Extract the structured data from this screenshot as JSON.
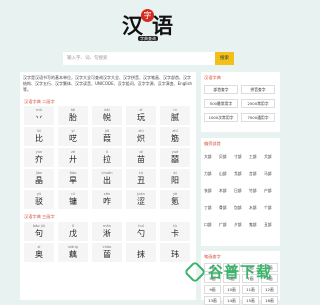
{
  "logo": {
    "left_char": "汉",
    "seal_char": "字",
    "right_char": "语",
    "sub": "字典查询"
  },
  "search": {
    "placeholder": "输入字、词、句搜索",
    "button": "搜索"
  },
  "intro": "汉字是汉语书写的基本单位，汉字大全可查询汉字大全、汉字拼音、汉字笔画、汉字部首、汉字结构、汉字五行、汉字繁体、汉字读音、UNICODE、汉字组词、汉字字源、汉字演变、English等。",
  "sections": [
    {
      "title": "汉语字典 二画字",
      "cells": [
        {
          "py": "mǔ",
          "hz": "丷"
        },
        {
          "py": "tái",
          "hz": "胎"
        },
        {
          "py": "kāi",
          "hz": "帨"
        },
        {
          "py": "zǐ",
          "hz": "玩"
        },
        {
          "py": "nì",
          "hz": "腻"
        },
        {
          "py": "bǐ",
          "hz": "比"
        },
        {
          "py": "yì",
          "hz": "呓"
        },
        {
          "py": "jiā",
          "hz": "葭"
        },
        {
          "py": "zhì",
          "hz": "炽"
        },
        {
          "py": "zhī",
          "hz": "筋"
        },
        {
          "py": "yún",
          "hz": "夰"
        },
        {
          "py": "zè",
          "hz": "廾"
        },
        {
          "py": "lì",
          "hz": "拉"
        },
        {
          "py": "qǐ",
          "hz": "苗"
        },
        {
          "py": "yuè",
          "hz": "囍"
        },
        {
          "py": "jiàn",
          "hz": "晶"
        },
        {
          "py": "tiǎo",
          "hz": "旱"
        },
        {
          "py": "chuǎn",
          "hz": "出"
        },
        {
          "py": "tǔ",
          "hz": "丑"
        },
        {
          "py": "ài",
          "hz": "阳"
        },
        {
          "py": "yǔ",
          "hz": "驳"
        },
        {
          "py": "nǐ",
          "hz": "镛"
        },
        {
          "py": "cān",
          "hz": "咋"
        },
        {
          "py": "juàn",
          "hz": "涩"
        },
        {
          "py": "yè",
          "hz": "氪"
        }
      ]
    },
    {
      "title": "汉语字典 三画字",
      "cells": [
        {
          "py": "bāo jiǔ",
          "hz": "句"
        },
        {
          "py": "lǐ",
          "hz": "戊"
        },
        {
          "py": "mǎn",
          "hz": "淅"
        },
        {
          "py": "huǐ",
          "hz": "勺"
        },
        {
          "py": "tù",
          "hz": "卡"
        },
        {
          "py": "zǐ",
          "hz": "奥"
        },
        {
          "py": "xiāng",
          "hz": "藕"
        },
        {
          "py": "cháo",
          "hz": "蒈"
        },
        {
          "py": "",
          "hz": "抹"
        },
        {
          "py": "",
          "hz": "玮"
        }
      ]
    }
  ],
  "side_strokes": {
    "title": "汉语字典",
    "buttons": [
      "部首查字",
      "拼音查字",
      "500最常用字",
      "2500常用字",
      "1000次常用字",
      "7000通用字"
    ]
  },
  "side_radicals": {
    "title": "偏旁部首",
    "items": [
      "大部",
      "贝部",
      "寸部",
      "工部",
      "犬部",
      "力部",
      "山部",
      "戈部",
      "言部",
      "马部",
      "衣部",
      "木部",
      "日部",
      "竹部",
      "户部",
      "丁部",
      "骨部",
      "包部",
      "水部",
      "个部",
      "口部",
      "疒部",
      "夕部",
      "鬼部",
      "丑部"
    ]
  },
  "side_strokes2": {
    "title": "笔画查字",
    "items": [
      "1画",
      "2画",
      "3画",
      "4画",
      "5画",
      "6画",
      "7画",
      "8画",
      "9画",
      "10画",
      "11画",
      "12画",
      "13画",
      "14画",
      "15画",
      "16画"
    ]
  },
  "watermark": {
    "text": "谷普下载",
    "domain": "CN"
  }
}
